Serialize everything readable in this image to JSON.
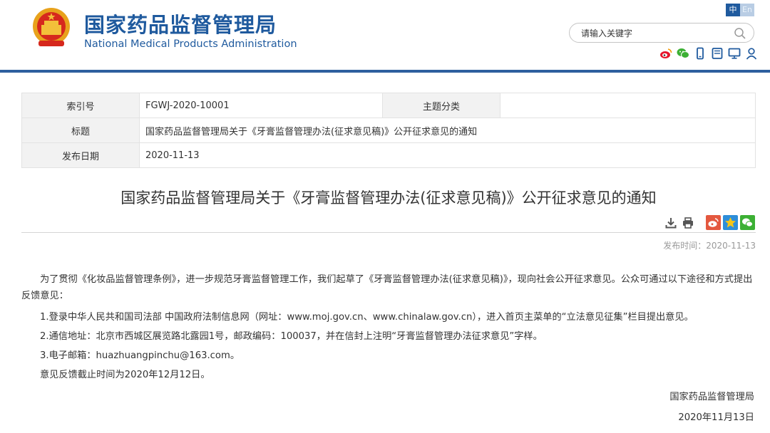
{
  "header": {
    "title_cn": "国家药品监督管理局",
    "title_en": "National Medical Products Administration",
    "lang_zh": "中",
    "lang_en": "En",
    "search_placeholder": "请输入关键字",
    "brand_color": "#1f5a9e",
    "social_icons": [
      "weibo-icon",
      "wechat-icon",
      "mobile-icon",
      "tablet-icon",
      "monitor-icon",
      "user-icon"
    ]
  },
  "meta": {
    "index_label": "索引号",
    "index_value": "FGWJ-2020-10001",
    "topic_label": "主题分类",
    "topic_value": "",
    "title_label": "标题",
    "title_value": "国家药品监督管理局关于《牙膏监督管理办法(征求意见稿)》公开征求意见的通知",
    "date_label": "发布日期",
    "date_value": "2020-11-13"
  },
  "article": {
    "title": "国家药品监督管理局关于《牙膏监督管理办法(征求意见稿)》公开征求意见的通知",
    "publish_time": "发布时间：2020-11-13",
    "paragraphs": [
      "为了贯彻《化妆品监督管理条例》，进一步规范牙膏监督管理工作，我们起草了《牙膏监督管理办法(征求意见稿)》，现向社会公开征求意见。公众可通过以下途径和方式提出反馈意见：",
      "1.登录中华人民共和国司法部 中国政府法制信息网（网址：www.moj.gov.cn、www.chinalaw.gov.cn），进入首页主菜单的“立法意见征集”栏目提出意见。",
      "2.通信地址：北京市西城区展览路北露园1号，邮政编码：100037，并在信封上注明“牙膏监督管理办法征求意见”字样。",
      "3.电子邮箱：huazhuangpinchu@163.com。",
      "意见反馈截止时间为2020年12月12日。"
    ],
    "signature": "国家药品监督管理局",
    "sign_date": "2020年11月13日"
  }
}
